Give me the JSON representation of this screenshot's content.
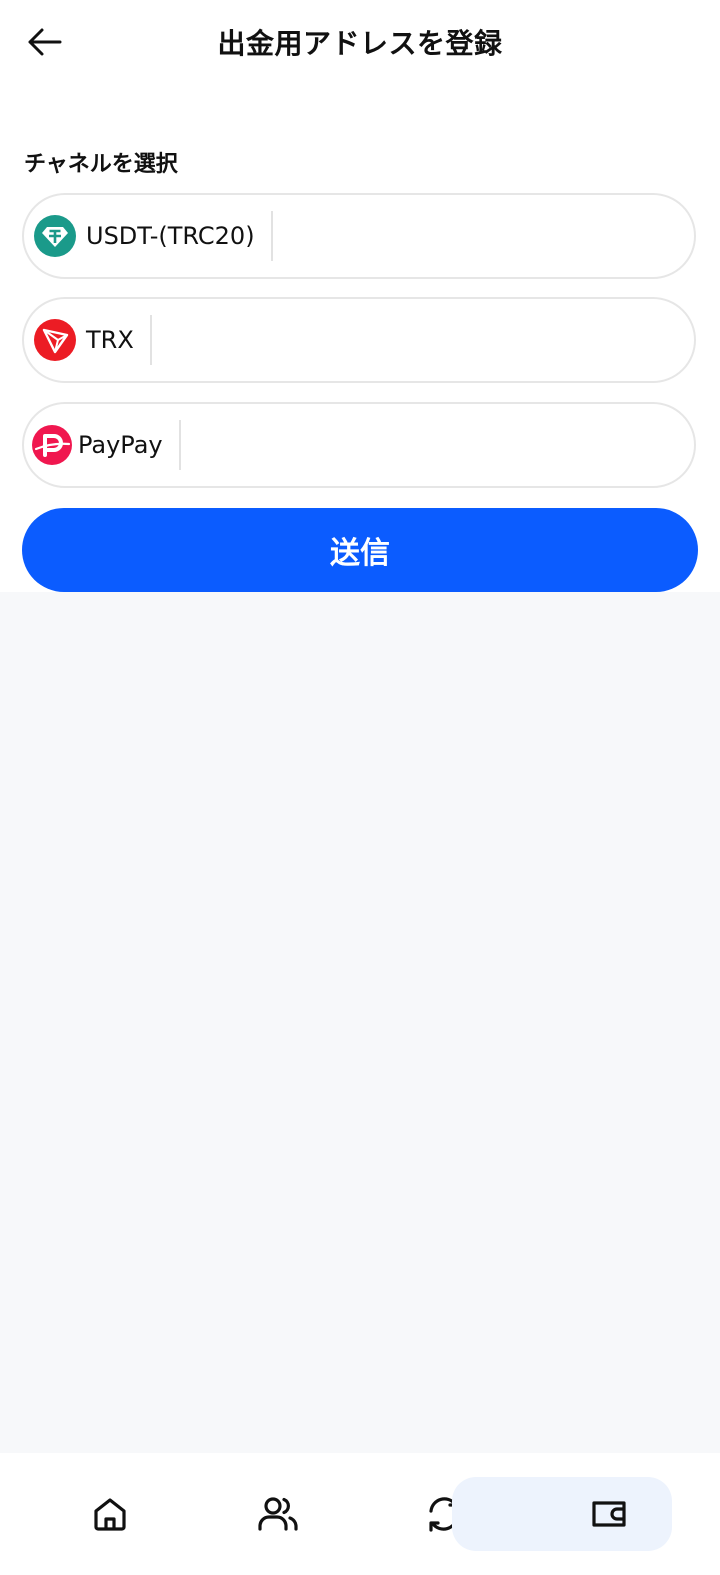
{
  "header": {
    "title": "出金用アドレスを登録",
    "back_icon": "arrow-left-icon"
  },
  "section_label": "チャネルを選択",
  "channels": [
    {
      "name": "USDT-(TRC20)",
      "icon": "tether-icon",
      "color": "#1a9a8a"
    },
    {
      "name": "TRX",
      "icon": "tron-icon",
      "color": "#ec1c24"
    },
    {
      "name": "PayPay",
      "icon": "paypay-icon",
      "color": "#f0174f"
    }
  ],
  "submit_label": "送信",
  "colors": {
    "accent": "#0b5cff",
    "page_background": "#f7f8fa",
    "active_tab_background": "#edf3fd"
  },
  "tabbar": {
    "items": [
      {
        "icon": "home-icon",
        "active": false
      },
      {
        "icon": "users-icon",
        "active": false
      },
      {
        "icon": "refresh-icon",
        "active": false
      },
      {
        "icon": "wallet-icon",
        "active": true
      }
    ]
  }
}
